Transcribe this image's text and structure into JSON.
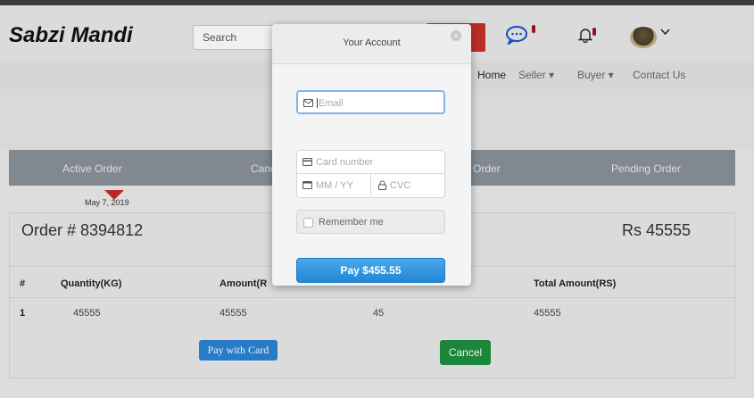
{
  "header": {
    "brand": "Sabzi Mandi",
    "search_placeholder": "Search"
  },
  "nav": {
    "items": [
      "Home",
      "Seller ▾",
      "Buyer ▾",
      "Contact Us"
    ]
  },
  "tabs": [
    "Active Order",
    "Canc",
    "Order",
    "Pending Order"
  ],
  "order": {
    "date": "May 7, 2019",
    "title": "Order # 8394812",
    "amount": "Rs 45555",
    "columns": [
      "#",
      "Quantity(KG)",
      "Amount(R",
      "Total Amount(RS)"
    ],
    "row": [
      "1",
      "45555",
      "45555",
      "45",
      "45555"
    ],
    "pay_with_card_label": "Pay with Card",
    "cancel_label": "Cancel"
  },
  "modal": {
    "title": "Your Account",
    "close_glyph": "×",
    "email_placeholder": "Email",
    "card_number_placeholder": "Card number",
    "expiry_placeholder": "MM / YY",
    "cvc_placeholder": "CVC",
    "remember_label": "Remember me",
    "pay_label": "Pay $455.55"
  },
  "colors": {
    "accent_blue": "#2b83d6",
    "danger_red": "#c9302c",
    "success_green": "#1e8f3e",
    "tab_bar": "#8a9199"
  }
}
